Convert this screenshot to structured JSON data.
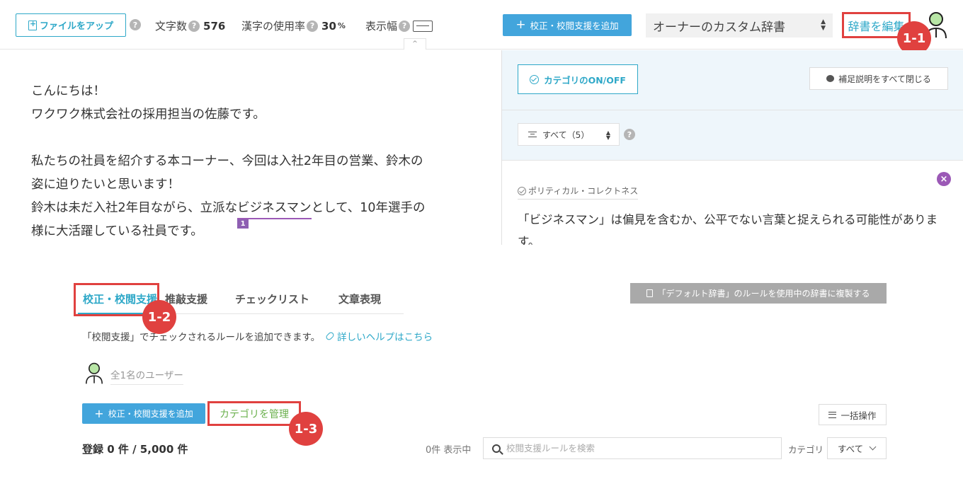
{
  "toolbar": {
    "upload_label": "ファイルをアップ",
    "char_count_label": "文字数",
    "char_count_value": "576",
    "kanji_rate_label": "漢字の使用率",
    "kanji_rate_value": "30",
    "kanji_rate_unit": "%",
    "display_width_label": "表示幅",
    "add_proofread_label": "校正・校閲支援を追加",
    "dictionary_selected": "オーナーのカスタム辞書",
    "edit_dictionary_label": "辞書を編集",
    "collapse_glyph": "^"
  },
  "editor": {
    "line1": "こんにちは！",
    "line2": "ワクワク株式会社の採用担当の佐藤です。",
    "line3": "私たちの社員を紹介する本コーナー、今回は入社2年目の営業、鈴木の",
    "line4": "姿に迫りたいと思います！",
    "line5_before": "鈴木は未だ入社2年目ながら、立派な",
    "line5_flagged": "ビジネスマン",
    "line5_after": "として、10年選手の",
    "line6": "様に大活躍している社員です。",
    "flag_number": "1"
  },
  "side_panel": {
    "category_toggle_label": "カテゴリのON/OFF",
    "close_all_label": "補足説明をすべて閉じる",
    "filter_label": "すべて（5）",
    "issue": {
      "category": "ポリティカル・コレクトネス",
      "message": "「ビジネスマン」は偏見を含むか、公平でない言葉と捉えられる可能性がありま す。",
      "close_glyph": "×"
    }
  },
  "bottom": {
    "tabs": [
      {
        "label": "校正・校閲支援"
      },
      {
        "label": "推敲支援"
      },
      {
        "label": "チェックリスト"
      },
      {
        "label": "文章表現"
      }
    ],
    "copy_rules_label": "「デフォルト辞書」のルールを使用中の辞書に複製する",
    "description": "「校閲支援」でチェックされるルールを追加できます。",
    "help_link": "詳しいヘルプはこちら",
    "users_count": "全1名のユーザー",
    "add_label": "校正・校閲支援を追加",
    "manage_category_label": "カテゴリを管理",
    "bulk_label": "一括操作",
    "registered_count": "登録 0 件 / 5,000 件",
    "showing_count": "0件 表示中",
    "search_placeholder": "校閲支援ルールを検索",
    "category_label": "カテゴリ",
    "category_selected": "すべて"
  },
  "annotations": {
    "badge_1_1": "1-1",
    "badge_1_2": "1-2",
    "badge_1_3": "1-3"
  },
  "icons": [
    "upload-icon",
    "help-icon",
    "width-icon",
    "plus-icon",
    "select-arrows-icon",
    "avatar-icon",
    "check-circle-icon",
    "speech-bubble-icon",
    "filter-icon",
    "close-icon",
    "copy-icon",
    "link-icon",
    "search-icon",
    "menu-icon",
    "chevron-down-icon"
  ],
  "colors": {
    "accent": "#2ea8c8",
    "primary_button": "#42a5dc",
    "highlight_border": "#e0413f",
    "issue_purple": "#9b59b6",
    "manage_category_text": "#6ab04c"
  }
}
